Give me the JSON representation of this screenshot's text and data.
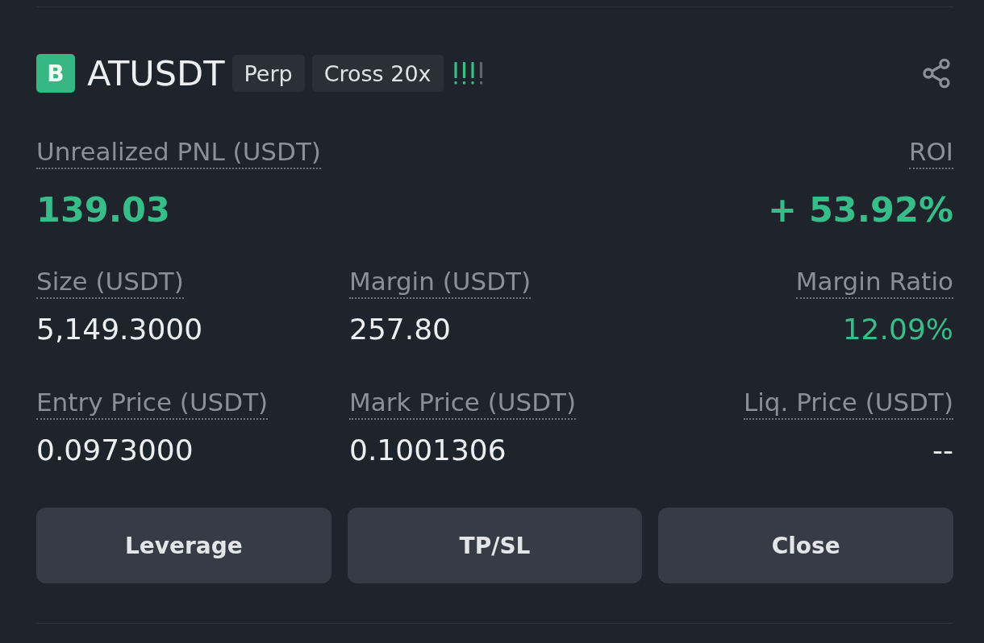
{
  "position": {
    "side_badge": "B",
    "symbol": "ATUSDT",
    "tags": [
      "Perp",
      "Cross 20x"
    ],
    "risk_meter": {
      "level": 0.75
    }
  },
  "headline": [
    {
      "label": "Unrealized PNL (USDT)",
      "value": "139.03",
      "kind": "gain"
    },
    {
      "label": "ROI",
      "value": "+ 53.92%",
      "kind": "gain"
    }
  ],
  "fields": [
    {
      "label": "Size (USDT)",
      "value": "5,149.3000",
      "kind": "plain"
    },
    {
      "label": "Margin (USDT)",
      "value": "257.80",
      "kind": "plain"
    },
    {
      "label": "Margin Ratio",
      "value": "12.09%",
      "kind": "gain"
    },
    {
      "label": "Entry Price (USDT)",
      "value": "0.0973000",
      "kind": "plain"
    },
    {
      "label": "Mark Price (USDT)",
      "value": "0.1001306",
      "kind": "plain"
    },
    {
      "label": "Liq. Price (USDT)",
      "value": "--",
      "kind": "plain"
    }
  ],
  "buttons": [
    "Leverage",
    "TP/SL",
    "Close"
  ]
}
